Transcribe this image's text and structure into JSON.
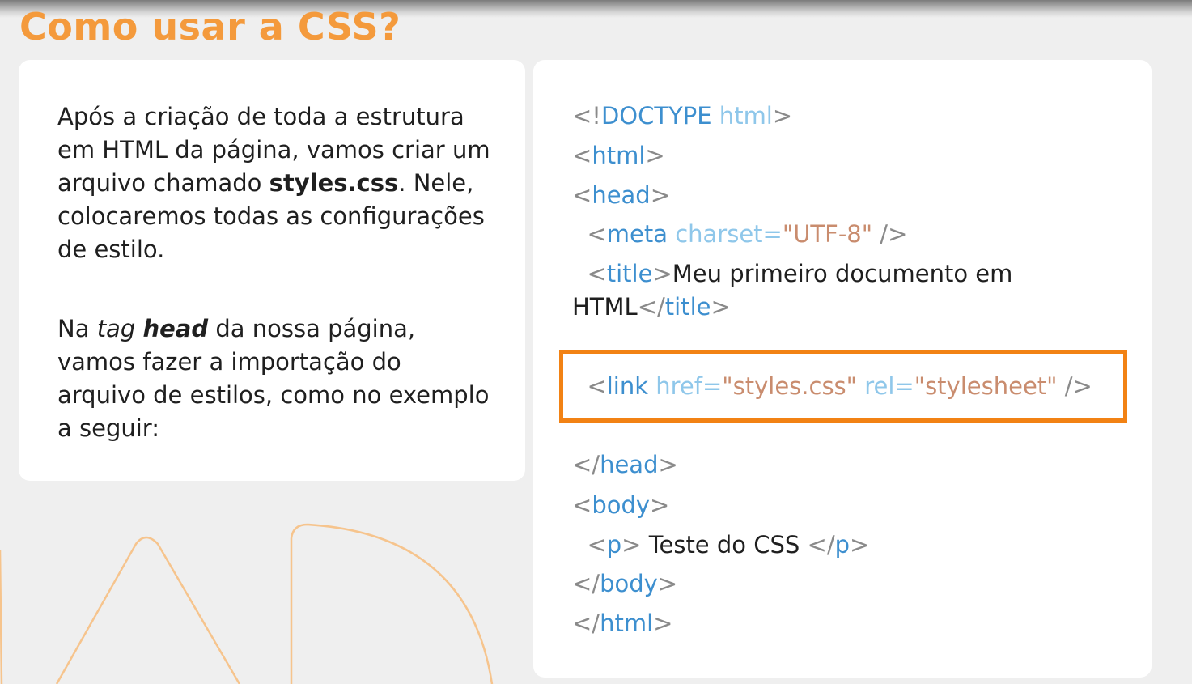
{
  "slide": {
    "title": "Como usar a CSS?"
  },
  "explanation": {
    "p1": {
      "before": "Após a criação de toda a estrutura em HTML da página, vamos criar um arquivo chamado ",
      "filename": "styles.css",
      "after": ". Nele, colocaremos todas as configurações de estilo."
    },
    "p2": {
      "before": "Na ",
      "tag_word": "tag",
      "space": " ",
      "head_word": "head",
      "after": " da nossa página, vamos fazer a importação do arquivo de estilos, como no exemplo a seguir:"
    }
  },
  "code": {
    "doctype": {
      "open": "<!",
      "keyword": "DOCTYPE",
      "attr": " html",
      "close": ">"
    },
    "html_open": {
      "open": "<",
      "name": "html",
      "close": ">"
    },
    "head_open": {
      "open": "<",
      "name": "head",
      "close": ">"
    },
    "meta": {
      "indent": "  ",
      "open": "<",
      "name": "meta",
      "attr": " charset",
      "eq": "=",
      "value": "\"UTF-8\"",
      "close": " />"
    },
    "title": {
      "indent": "  ",
      "open": "<",
      "name": "title",
      "close": ">",
      "text_a": "Meu primeiro documento em",
      "text_b": "HTML",
      "end_open": "</",
      "end_close": ">"
    },
    "link": {
      "indent": "  ",
      "open": "<",
      "name": "link",
      "attr1": " href",
      "eq1": "=",
      "value1": "\"styles.css\"",
      "attr2": " rel",
      "eq2": "=",
      "value2": "\"stylesheet\"",
      "close": " />"
    },
    "head_close": {
      "open": "</",
      "name": "head",
      "close": ">"
    },
    "body_open": {
      "open": "<",
      "name": "body",
      "close": ">"
    },
    "p": {
      "indent": "  ",
      "open": "<",
      "name": "p",
      "close": ">",
      "text": " Teste do CSS ",
      "end_open": "</",
      "end_close": ">"
    },
    "body_close": {
      "open": "</",
      "name": "body",
      "close": ">"
    },
    "html_close": {
      "open": "</",
      "name": "html",
      "close": ">"
    }
  },
  "colors": {
    "title": "#f49a3c",
    "highlight_border": "#f28214",
    "tag_name": "#3d8fcf",
    "attribute": "#8fc7ea",
    "attribute_value": "#c98c6e",
    "punctuation": "#8a8a8a",
    "background": "#efefef",
    "card": "#ffffff"
  }
}
